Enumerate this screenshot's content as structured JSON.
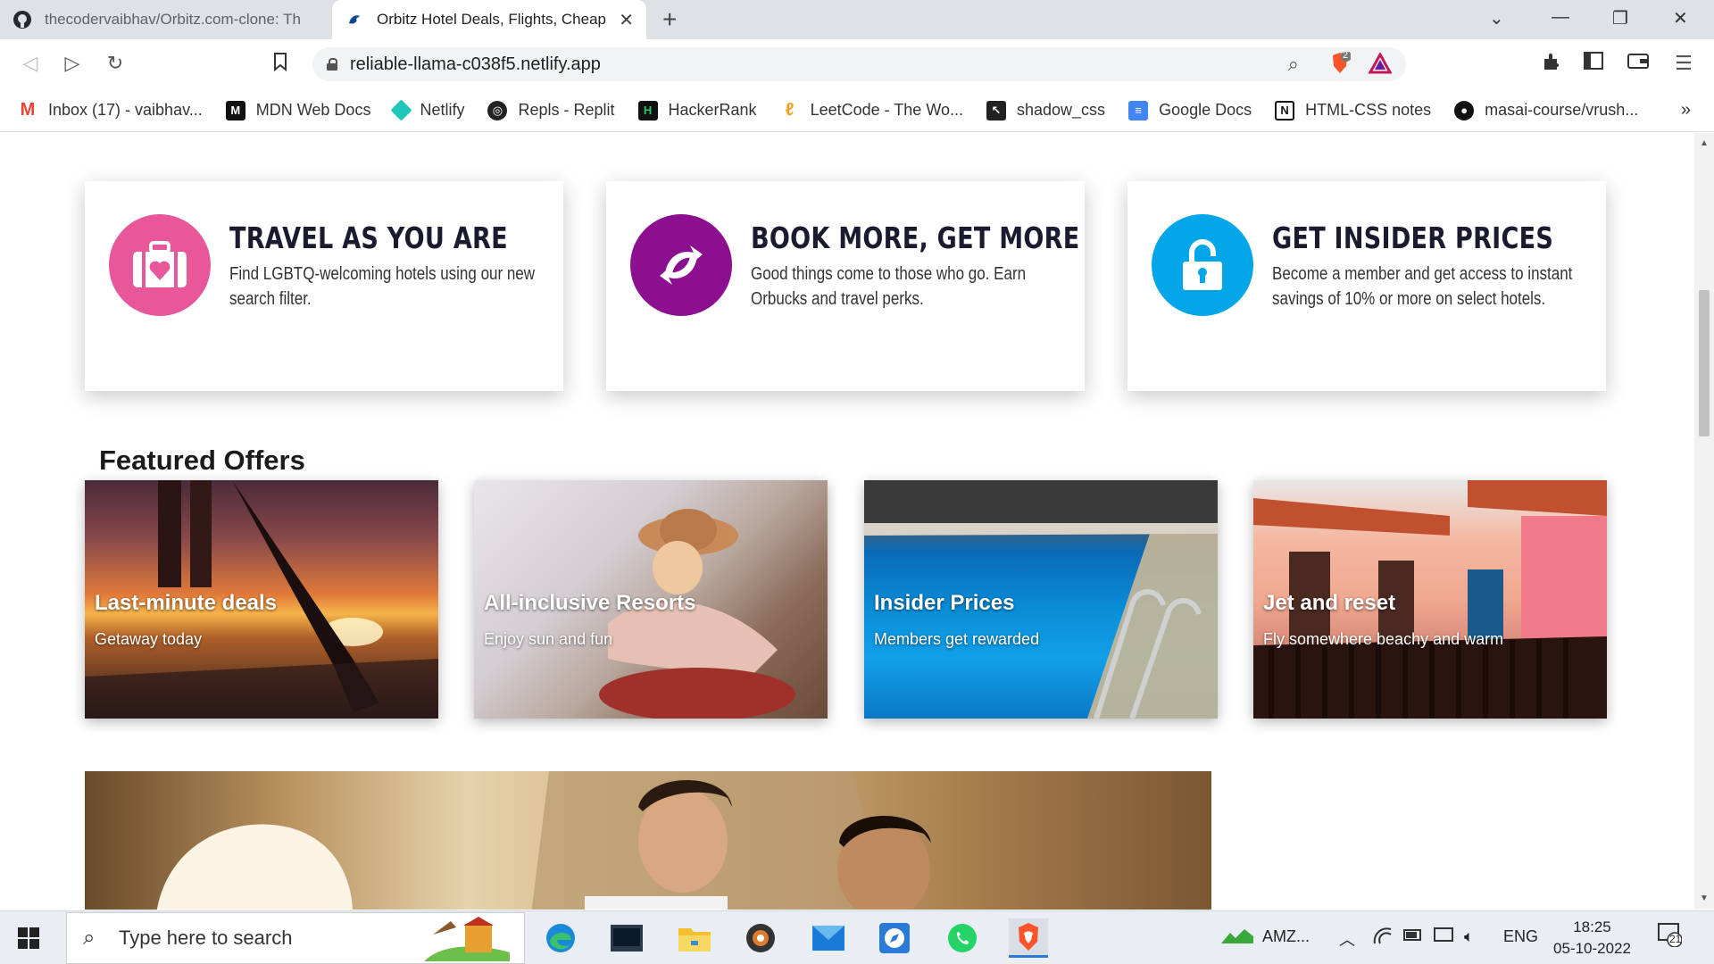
{
  "browser": {
    "tabs": [
      {
        "label": "thecodervaibhav/Orbitz.com-clone: Th",
        "active": false
      },
      {
        "label": "Orbitz Hotel Deals, Flights, Cheap",
        "active": true
      }
    ],
    "url": "reliable-llama-c038f5.netlify.app",
    "shield_badge": "2"
  },
  "bookmarks": [
    {
      "label": "Inbox (17) - vaibhav...",
      "icon": "gmail-icon",
      "color": "#ea4335"
    },
    {
      "label": "MDN Web Docs",
      "icon": "mdn-icon",
      "color": "#111111"
    },
    {
      "label": "Netlify",
      "icon": "netlify-icon",
      "color": "#20c6b7"
    },
    {
      "label": "Repls - Replit",
      "icon": "replit-icon",
      "color": "#222222"
    },
    {
      "label": "HackerRank",
      "icon": "hackerrank-icon",
      "color": "#111111"
    },
    {
      "label": "LeetCode - The Wo...",
      "icon": "leetcode-icon",
      "color": "#f89f1b"
    },
    {
      "label": "shadow_css",
      "icon": "shadow-css-icon",
      "color": "#222222"
    },
    {
      "label": "Google Docs",
      "icon": "google-docs-icon",
      "color": "#4285f4"
    },
    {
      "label": "HTML-CSS notes",
      "icon": "notion-icon",
      "color": "#111111"
    },
    {
      "label": "masai-course/vrush...",
      "icon": "github-icon",
      "color": "#111111"
    }
  ],
  "promos": [
    {
      "title": "TRAVEL AS YOU ARE",
      "desc": "Find LGBTQ-welcoming hotels using our new search filter.",
      "color": "#e8579a",
      "icon": "suitcase-heart-icon"
    },
    {
      "title": "BOOK MORE, GET MORE",
      "desc": "Good things come to those who go. Earn Orbucks and travel perks.",
      "color": "#8b0f8e",
      "icon": "orbucks-swap-icon"
    },
    {
      "title": "GET INSIDER PRICES",
      "desc": "Become a member and get access to instant savings of 10% or more on select hotels.",
      "color": "#00a6e8",
      "icon": "unlock-icon"
    }
  ],
  "featured": {
    "heading": "Featured Offers",
    "offers": [
      {
        "title": "Last-minute deals",
        "subtitle": "Getaway today"
      },
      {
        "title": "All-inclusive Resorts",
        "subtitle": "Enjoy sun and fun"
      },
      {
        "title": "Insider Prices",
        "subtitle": "Members get rewarded"
      },
      {
        "title": "Jet and reset",
        "subtitle": "Fly somewhere beachy and warm"
      }
    ]
  },
  "taskbar": {
    "search_placeholder": "Type here to search",
    "tray_app": "AMZ...",
    "language": "ENG",
    "time": "18:25",
    "date": "05-10-2022",
    "notifications": "21"
  }
}
